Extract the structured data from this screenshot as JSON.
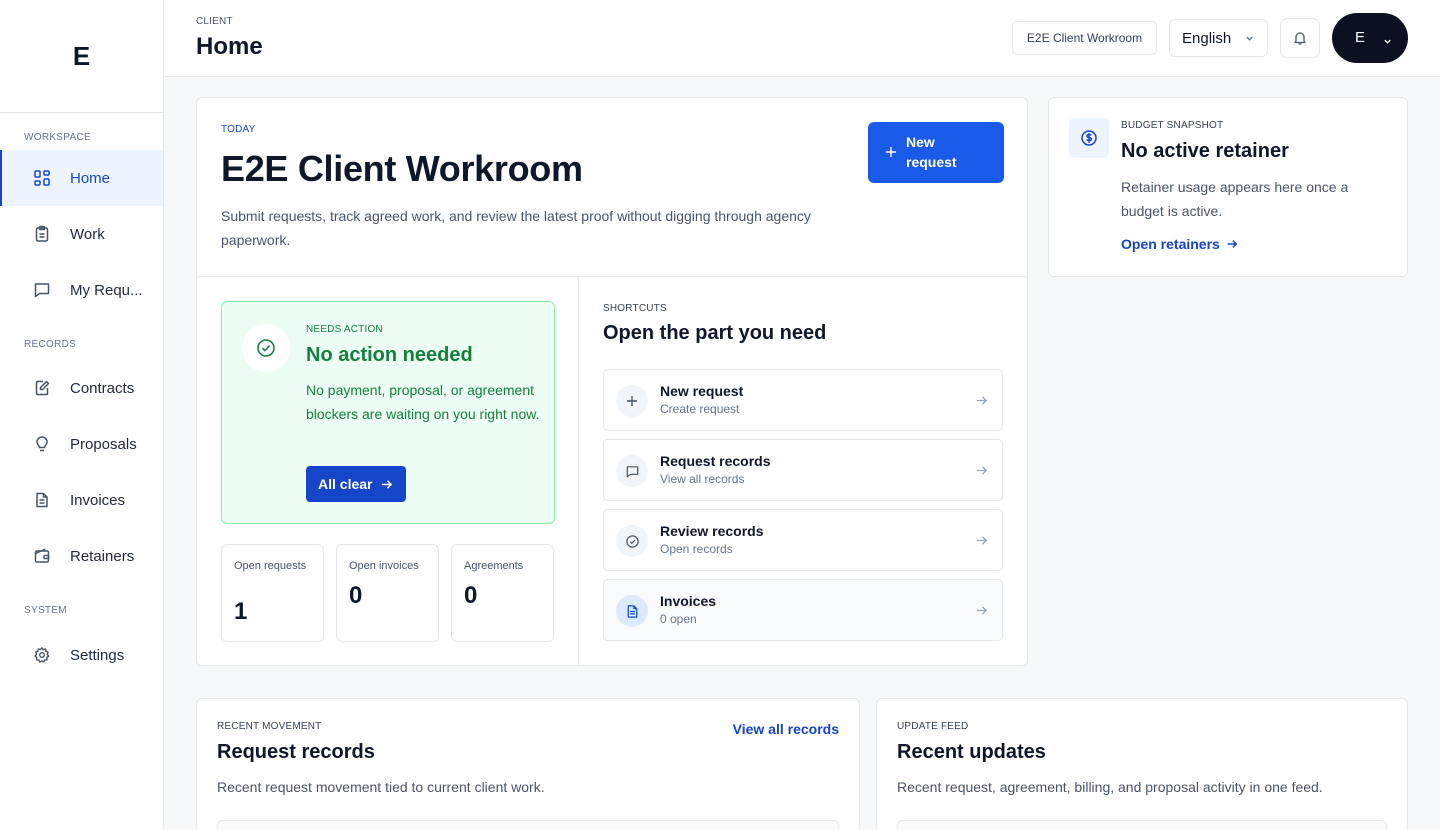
{
  "sidebar": {
    "logo": "E",
    "sections": [
      "WORKSPACE",
      "RECORDS",
      "SYSTEM"
    ],
    "items": [
      {
        "label": "Home",
        "icon": "grid-icon"
      },
      {
        "label": "Work",
        "icon": "clipboard-icon"
      },
      {
        "label": "My Requ...",
        "icon": "message-icon"
      },
      {
        "label": "Contracts",
        "icon": "pen-document-icon"
      },
      {
        "label": "Proposals",
        "icon": "lightbulb-icon"
      },
      {
        "label": "Invoices",
        "icon": "document-icon"
      },
      {
        "label": "Retainers",
        "icon": "wallet-icon"
      },
      {
        "label": "Settings",
        "icon": "gear-icon"
      }
    ]
  },
  "header": {
    "breadcrumb": "CLIENT",
    "title": "Home",
    "workspace": "E2E Client Workroom",
    "language": "English",
    "avatar_initial": "E"
  },
  "main": {
    "eyebrow": "TODAY",
    "title": "E2E Client Workroom",
    "description": "Submit requests, track agreed work, and review the latest proof without digging through agency paperwork.",
    "new_request_label": "New request",
    "action": {
      "eyebrow": "NEEDS ACTION",
      "title": "No action needed",
      "body": "No payment, proposal, or agreement blockers are waiting on you right now.",
      "button": "All clear"
    },
    "stats": [
      {
        "label": "Open requests",
        "value": "1"
      },
      {
        "label": "Open invoices",
        "value": "0"
      },
      {
        "label": "Agreements",
        "value": "0"
      }
    ],
    "shortcuts": {
      "eyebrow": "SHORTCUTS",
      "title": "Open the part you need",
      "items": [
        {
          "title": "New request",
          "sub": "Create request",
          "icon": "plus-icon"
        },
        {
          "title": "Request records",
          "sub": "View all records",
          "icon": "message-icon"
        },
        {
          "title": "Review records",
          "sub": "Open records",
          "icon": "check-circle-icon"
        },
        {
          "title": "Invoices",
          "sub": "0 open",
          "icon": "document-icon"
        }
      ]
    }
  },
  "budget": {
    "eyebrow": "BUDGET SNAPSHOT",
    "title": "No active retainer",
    "body": "Retainer usage appears here once a budget is active.",
    "link": "Open retainers"
  },
  "records": {
    "eyebrow": "RECENT MOVEMENT",
    "title": "Request records",
    "body": "Recent request movement tied to current client work.",
    "view_all": "View all records"
  },
  "updates": {
    "eyebrow": "UPDATE FEED",
    "title": "Recent updates",
    "body": "Recent request, agreement, billing, and proposal activity in one feed."
  },
  "colors": {
    "accent": "#1546c9",
    "primary_button": "#1a5ae8",
    "success": "#15803d",
    "success_bg": "#ecfdf3"
  }
}
